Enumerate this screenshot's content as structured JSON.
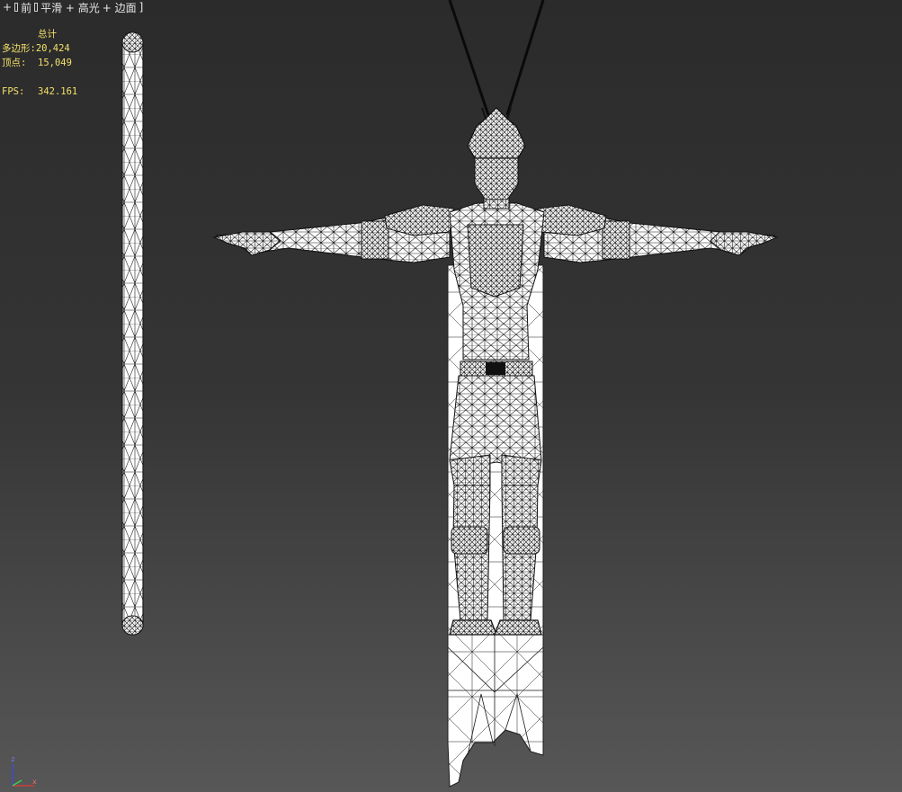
{
  "viewport": {
    "plus": "+",
    "view_label": "前",
    "shading_label": "平滑 + 高光",
    "edged_faces_label": "+ 边面",
    "close_bracket": "]"
  },
  "stats": {
    "title": "总计",
    "polys_label": "多边形:",
    "polys_value": "20,424",
    "verts_label": "顶点:",
    "verts_value": "15,049",
    "fps_label": "FPS:",
    "fps_value": "342.161"
  },
  "gizmo": {
    "z_label": "z",
    "x_label": "x"
  },
  "colors": {
    "stats_text": "#f3e06a",
    "wire": "#111111",
    "mesh_fill": "#ffffff",
    "axis_z": "#3a4fd0",
    "axis_x": "#d03a3a",
    "axis_y": "#3ad04a"
  },
  "scene_objects": [
    "staff",
    "monkey-king-character",
    "cape-banner",
    "hanging-ropes"
  ]
}
